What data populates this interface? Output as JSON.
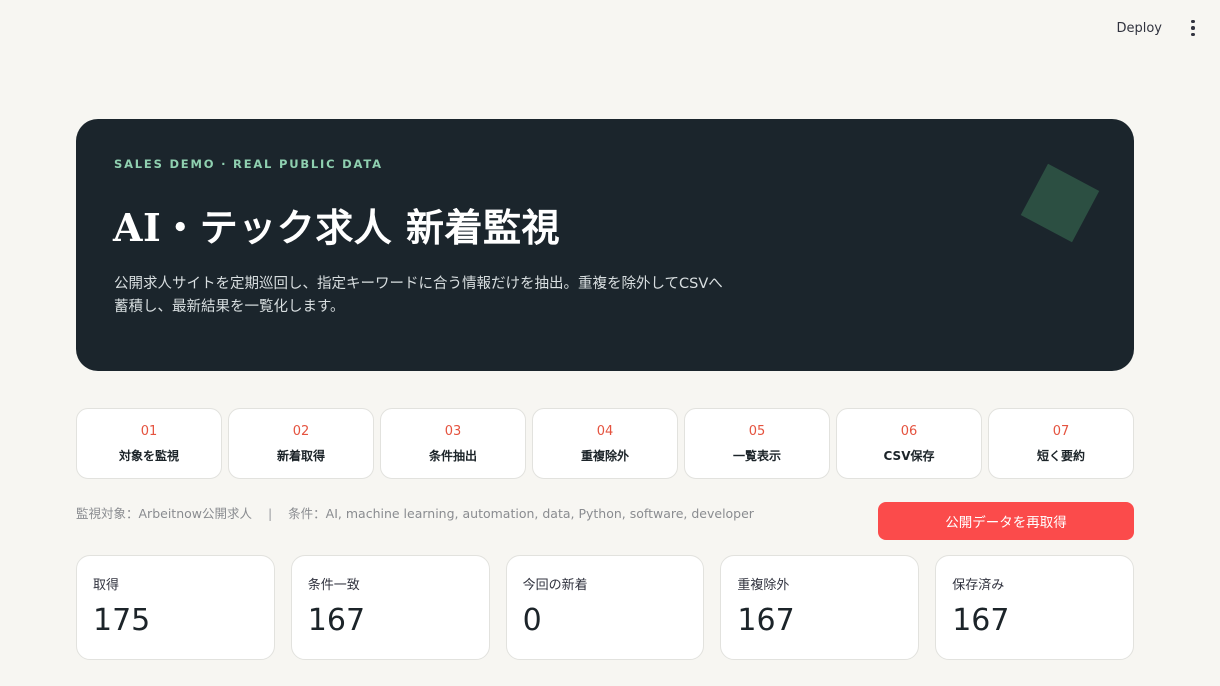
{
  "toolbar": {
    "deploy_label": "Deploy",
    "menu_icon": "more-vertical-icon"
  },
  "hero": {
    "eyebrow": "SALES DEMO · REAL PUBLIC DATA",
    "title": "AI・テック求人 新着監視",
    "description_line1": "公開求人サイトを定期巡回し、指定キーワードに合う情報だけを抽出。重複を除外してCSVへ",
    "description_line2": "蓄積し、最新結果を一覧化します。",
    "shape_color": "#2f5747",
    "background_color": "#1b252c"
  },
  "steps": [
    {
      "num": "01",
      "label": "対象を監視"
    },
    {
      "num": "02",
      "label": "新着取得"
    },
    {
      "num": "03",
      "label": "条件抽出"
    },
    {
      "num": "04",
      "label": "重複除外"
    },
    {
      "num": "05",
      "label": "一覧表示"
    },
    {
      "num": "06",
      "label": "CSV保存"
    },
    {
      "num": "07",
      "label": "短く要約"
    }
  ],
  "info": {
    "target": "監視対象：Arbeitnow公開求人",
    "separator": "|",
    "conditions": "条件：AI, machine learning, automation, data, Python, software, developer"
  },
  "refetch_button": {
    "label": "公開データを再取得",
    "color": "#fb4b4b"
  },
  "metrics": [
    {
      "label": "取得",
      "value": "175"
    },
    {
      "label": "条件一致",
      "value": "167"
    },
    {
      "label": "今回の新着",
      "value": "0"
    },
    {
      "label": "重複除外",
      "value": "167"
    },
    {
      "label": "保存済み",
      "value": "167"
    }
  ],
  "accent_color": "#e5533f"
}
